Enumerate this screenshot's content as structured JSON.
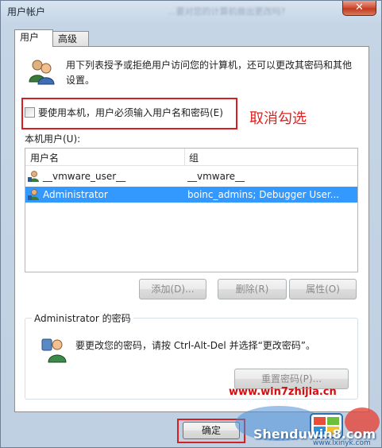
{
  "window": {
    "title": "用户帐户",
    "title_blurred": "...要对您的计算机做出更改吗?",
    "close_label": "✕"
  },
  "tabs": [
    {
      "label": "用户",
      "active": true
    },
    {
      "label": "高级",
      "active": false
    }
  ],
  "intro": "用下列表授予或拒绝用户访问您的计算机，还可以更改其密码和其他设置。",
  "checkbox": {
    "label": "要使用本机，用户必须输入用户名和密码(E)",
    "checked": false
  },
  "annotation": "取消勾选",
  "local_users_label": "本机用户(U):",
  "table": {
    "headers": [
      "用户名",
      "组"
    ],
    "rows": [
      {
        "name": "__vmware_user__",
        "group": "__vmware__",
        "selected": false
      },
      {
        "name": "Administrator",
        "group": "boinc_admins; Debugger User...",
        "selected": true
      }
    ]
  },
  "buttons": {
    "add": "添加(D)...",
    "delete": "删除(R)",
    "properties": "属性(O)",
    "reset_password": "重置密码(P)...",
    "ok": "确定"
  },
  "password_group": {
    "title": "Administrator 的密码",
    "text": "要更改您的密码，请按 Ctrl-Alt-Del 并选择“更改密码”。"
  },
  "watermark": {
    "url": "www.win7zhijia.cn",
    "site": "Shenduwin8.com",
    "site2": "www.lxinyk.com"
  },
  "colors": {
    "selection": "#3399ff",
    "annotation_red": "#d81e1e",
    "window_frame": "#c5d5e6"
  }
}
